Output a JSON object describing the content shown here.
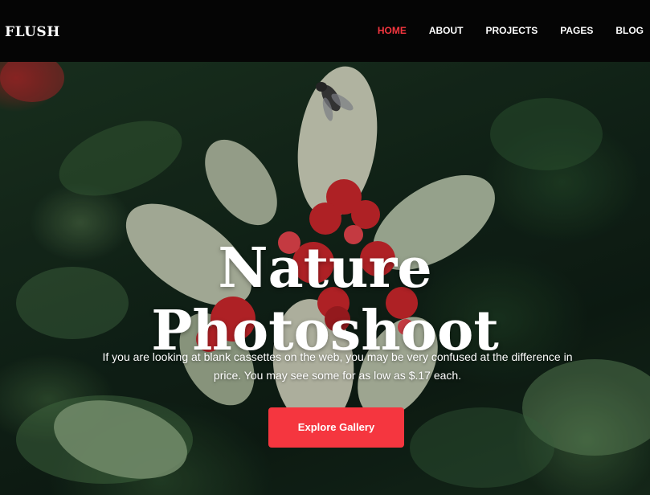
{
  "brand": {
    "logo": "FLUSH"
  },
  "nav": {
    "items": [
      {
        "label": "HOME",
        "active": true
      },
      {
        "label": "ABOUT",
        "active": false
      },
      {
        "label": "PROJECTS",
        "active": false
      },
      {
        "label": "PAGES",
        "active": false
      },
      {
        "label": "BLOG",
        "active": false
      }
    ]
  },
  "hero": {
    "title_line1": "Nature",
    "title_line2": "Photoshoot",
    "description": "If you are looking at blank cassettes on the web, you may be very confused at the difference in price. You may see some for as low as $.17 each.",
    "button_label": "Explore Gallery"
  },
  "colors": {
    "accent": "#f5363f",
    "navbar_bg": "#050505",
    "text": "#ffffff"
  }
}
